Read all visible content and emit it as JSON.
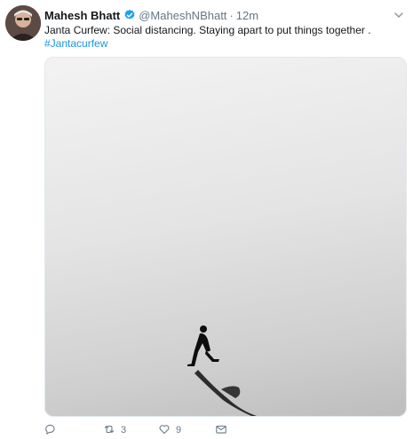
{
  "tweet": {
    "author_name": "Mahesh Bhatt",
    "handle": "@MaheshNBhatt",
    "separator": "·",
    "time": "12m",
    "text": "Janta Curfew: Social distancing. Staying apart to put things together .",
    "hashtag": "#Jantacurfew"
  },
  "icons": {
    "verified": "verified-badge-icon",
    "caret": "chevron-down-icon",
    "reply": "reply-icon",
    "retweet": "retweet-icon",
    "like": "heart-icon",
    "dm": "envelope-icon"
  },
  "actions": {
    "retweet_count": "3",
    "like_count": "9"
  },
  "colors": {
    "link": "#1b95e0",
    "secondary_text": "#657786",
    "verified": "#1da1f2"
  }
}
